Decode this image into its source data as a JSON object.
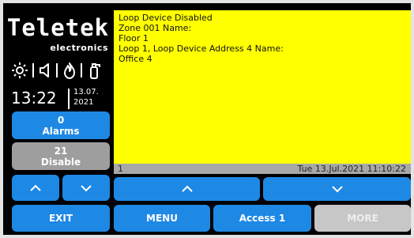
{
  "brand": {
    "name": "Teletek",
    "tagline": "electronics"
  },
  "status_icons": [
    "sun-icon",
    "speaker-icon",
    "flame-icon",
    "fire-extinguisher-icon"
  ],
  "clock": {
    "time": "13:22",
    "date_line1": "13.07.",
    "date_line2": "2021"
  },
  "counters": {
    "alarms": {
      "count": "0",
      "label": "Alarms",
      "color": "#1e88e5"
    },
    "disable": {
      "count": "21",
      "label": "Disable",
      "color": "#9e9e9e"
    }
  },
  "message": {
    "lines": [
      "Loop Device Disabled",
      "Zone 001 Name:",
      "Floor 1",
      "Loop 1, Loop Device Address 4 Name:",
      "Office 4"
    ],
    "background": "#ffff00"
  },
  "status_bar": {
    "index": "1",
    "datetime": "Tue 13.Jul.2021 11:10:22"
  },
  "bottom_buttons": {
    "exit": "EXIT",
    "menu": "MENU",
    "access": "Access 1",
    "more": "MORE"
  }
}
